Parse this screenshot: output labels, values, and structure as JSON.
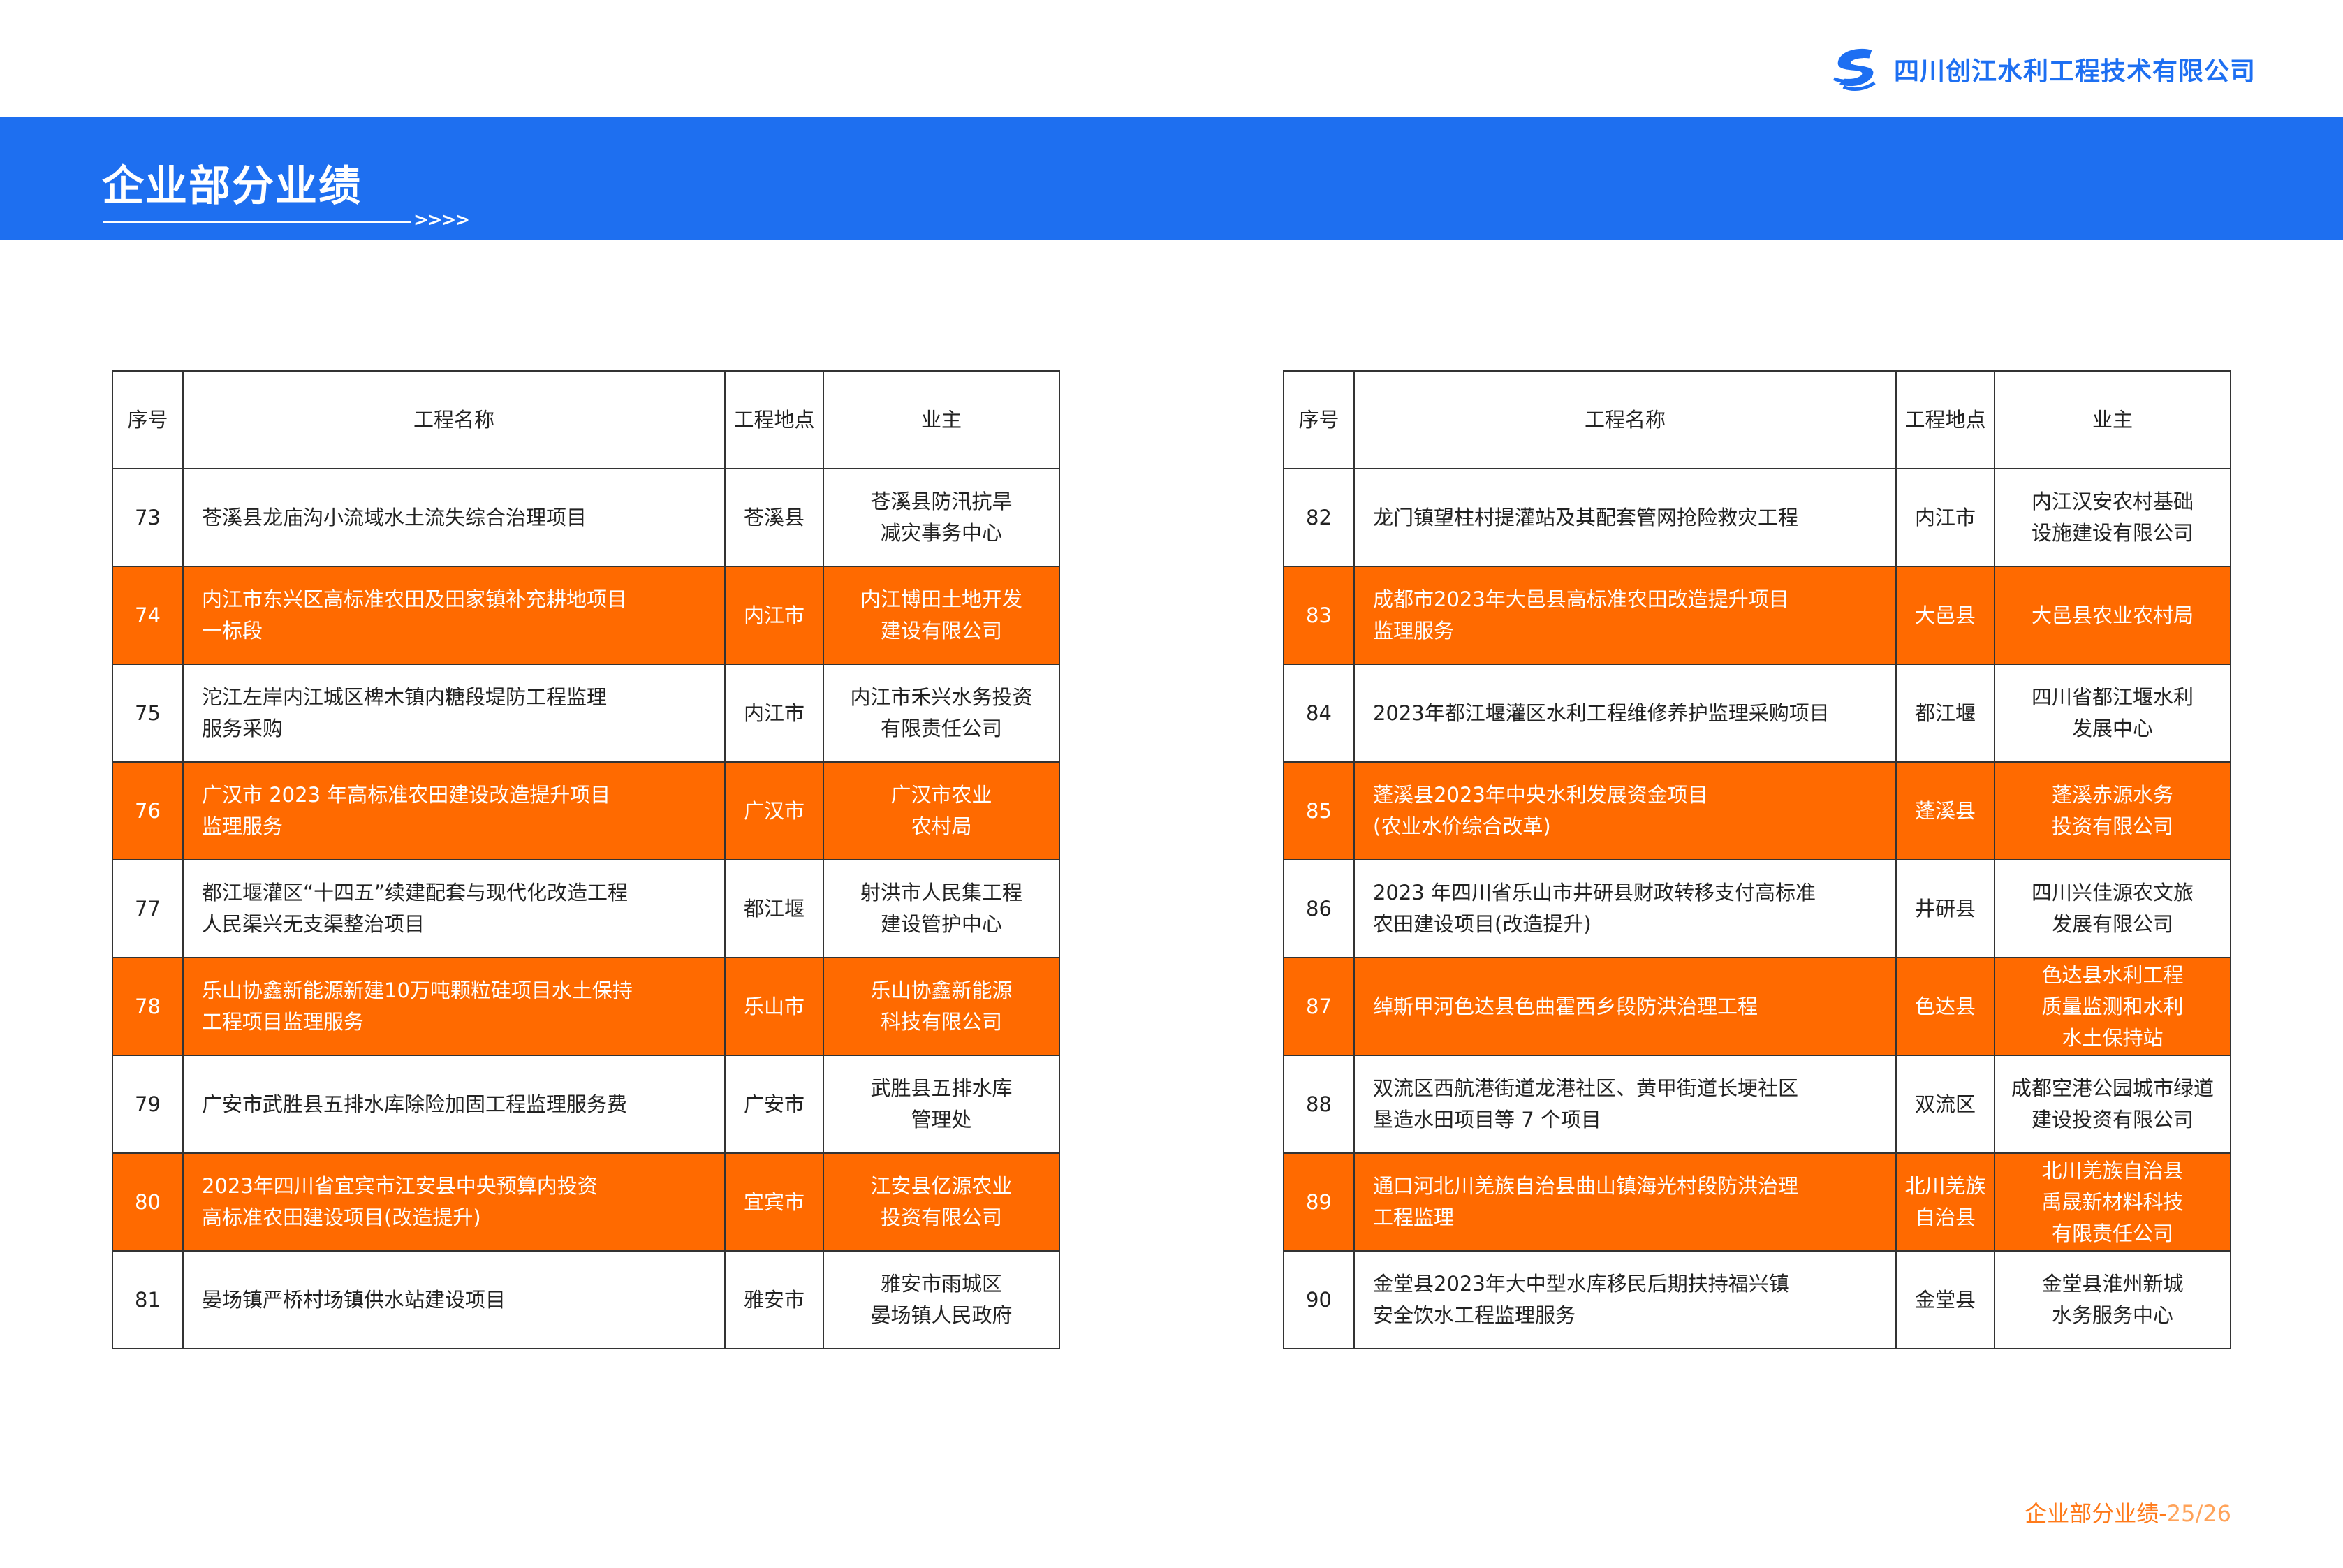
{
  "header": {
    "company_name": "四川创江水利工程技术有限公司",
    "logo_icon": "company-logo-icon",
    "accent": "#1e6ff0"
  },
  "banner": {
    "title": "企业部分业绩",
    "arrows": ">>>>"
  },
  "columns": {
    "no": "序号",
    "name": "工程名称",
    "location": "工程地点",
    "owner": "业主"
  },
  "left_rows": [
    {
      "no": "73",
      "name": [
        "苍溪县龙庙沟小流域水土流失综合治理项目"
      ],
      "location": [
        "苍溪县"
      ],
      "owner": [
        "苍溪县防汛抗旱",
        "减灾事务中心"
      ],
      "highlight": false
    },
    {
      "no": "74",
      "name": [
        "内江市东兴区高标准农田及田家镇补充耕地项目",
        "一标段"
      ],
      "location": [
        "内江市"
      ],
      "owner": [
        "内江博田土地开发",
        "建设有限公司"
      ],
      "highlight": true
    },
    {
      "no": "75",
      "name": [
        "沱江左岸内江城区椑木镇内糖段堤防工程监理",
        "服务采购"
      ],
      "location": [
        "内江市"
      ],
      "owner": [
        "内江市禾兴水务投资",
        "有限责任公司"
      ],
      "highlight": false
    },
    {
      "no": "76",
      "name": [
        "广汉市 2023 年高标准农田建设改造提升项目",
        "监理服务"
      ],
      "location": [
        "广汉市"
      ],
      "owner": [
        "广汉市农业",
        "农村局"
      ],
      "highlight": true
    },
    {
      "no": "77",
      "name": [
        "都江堰灌区“十四五”续建配套与现代化改造工程",
        "人民渠兴无支渠整治项目"
      ],
      "location": [
        "都江堰"
      ],
      "owner": [
        "射洪市人民集工程",
        "建设管护中心"
      ],
      "highlight": false
    },
    {
      "no": "78",
      "name": [
        "乐山协鑫新能源新建10万吨颗粒硅项目水土保持",
        "工程项目监理服务"
      ],
      "location": [
        "乐山市"
      ],
      "owner": [
        "乐山协鑫新能源",
        "科技有限公司"
      ],
      "highlight": true
    },
    {
      "no": "79",
      "name": [
        "广安市武胜县五排水库除险加固工程监理服务费"
      ],
      "location": [
        "广安市"
      ],
      "owner": [
        "武胜县五排水库",
        "管理处"
      ],
      "highlight": false
    },
    {
      "no": "80",
      "name": [
        "2023年四川省宜宾市江安县中央预算内投资",
        "高标准农田建设项目(改造提升)"
      ],
      "location": [
        "宜宾市"
      ],
      "owner": [
        "江安县亿源农业",
        "投资有限公司"
      ],
      "highlight": true
    },
    {
      "no": "81",
      "name": [
        "晏场镇严桥村场镇供水站建设项目"
      ],
      "location": [
        "雅安市"
      ],
      "owner": [
        "雅安市雨城区",
        "晏场镇人民政府"
      ],
      "highlight": false
    }
  ],
  "right_rows": [
    {
      "no": "82",
      "name": [
        "龙门镇望柱村提灌站及其配套管网抢险救灾工程"
      ],
      "location": [
        "内江市"
      ],
      "owner": [
        "内江汉安农村基础",
        "设施建设有限公司"
      ],
      "highlight": false
    },
    {
      "no": "83",
      "name": [
        "成都市2023年大邑县高标准农田改造提升项目",
        "监理服务"
      ],
      "location": [
        "大邑县"
      ],
      "owner": [
        "大邑县农业农村局"
      ],
      "highlight": true
    },
    {
      "no": "84",
      "name": [
        "2023年都江堰灌区水利工程维修养护监理采购项目"
      ],
      "location": [
        "都江堰"
      ],
      "owner": [
        "四川省都江堰水利",
        "发展中心"
      ],
      "highlight": false
    },
    {
      "no": "85",
      "name": [
        "蓬溪县2023年中央水利发展资金项目",
        "(农业水价综合改革)"
      ],
      "location": [
        "蓬溪县"
      ],
      "owner": [
        "蓬溪赤源水务",
        "投资有限公司"
      ],
      "highlight": true
    },
    {
      "no": "86",
      "name": [
        "2023 年四川省乐山市井研县财政转移支付高标准",
        "农田建设项目(改造提升)"
      ],
      "location": [
        "井研县"
      ],
      "owner": [
        "四川兴佳源农文旅",
        "发展有限公司"
      ],
      "highlight": false
    },
    {
      "no": "87",
      "name": [
        "绰斯甲河色达县色曲霍西乡段防洪治理工程"
      ],
      "location": [
        "色达县"
      ],
      "owner": [
        "色达县水利工程",
        "质量监测和水利",
        "水土保持站"
      ],
      "highlight": true
    },
    {
      "no": "88",
      "name": [
        "双流区西航港街道龙港社区、黄甲街道长埂社区",
        "垦造水田项目等 7 个项目"
      ],
      "location": [
        "双流区"
      ],
      "owner": [
        "成都空港公园城市绿道",
        "建设投资有限公司"
      ],
      "highlight": false
    },
    {
      "no": "89",
      "name": [
        "通口河北川羌族自治县曲山镇海光村段防洪治理",
        "工程监理"
      ],
      "location": [
        "北川羌族",
        "自治县"
      ],
      "owner": [
        "北川羌族自治县",
        "禹晟新材料科技",
        "有限责任公司"
      ],
      "highlight": true
    },
    {
      "no": "90",
      "name": [
        "金堂县2023年大中型水库移民后期扶持福兴镇",
        "安全饮水工程监理服务"
      ],
      "location": [
        "金堂县"
      ],
      "owner": [
        "金堂县淮州新城",
        "水务服务中心"
      ],
      "highlight": false
    }
  ],
  "footer": {
    "section": "企业部分业绩-",
    "page": "25/26",
    "color": "#ff7a1a"
  },
  "colors": {
    "row_highlight": "#ff6a00"
  }
}
